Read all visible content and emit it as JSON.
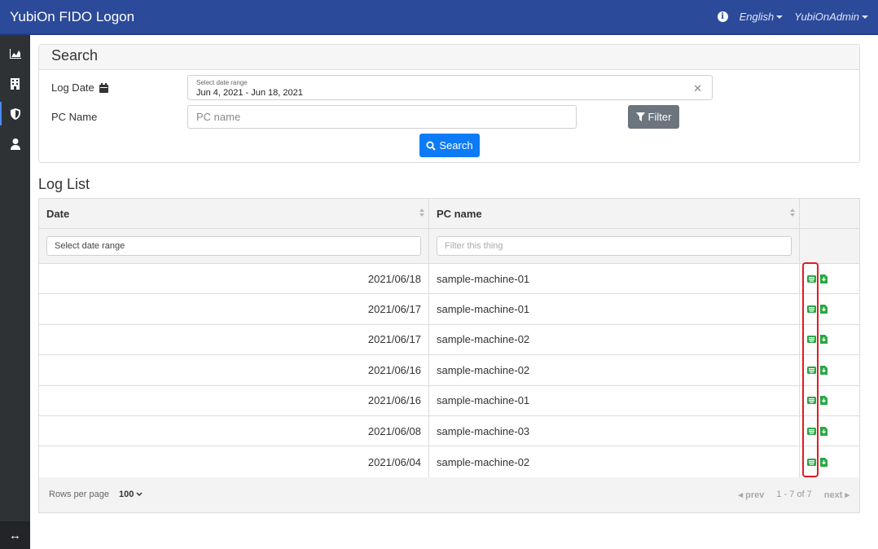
{
  "header": {
    "brand": "YubiOn FIDO Logon",
    "language": "English",
    "user": "YubiOnAdmin"
  },
  "sidebar": {
    "items": [
      {
        "icon": "area-chart-icon"
      },
      {
        "icon": "building-icon"
      },
      {
        "icon": "shield-icon",
        "active": true
      },
      {
        "icon": "user-icon"
      }
    ],
    "toggle_icon": "expand-arrows-icon"
  },
  "search": {
    "title": "Search",
    "log_date_label": "Log Date",
    "date_range_caption": "Select date range",
    "date_range_value": "Jun 4, 2021 - Jun 18, 2021",
    "pc_name_label": "PC Name",
    "pc_name_placeholder": "PC name",
    "filter_label": "Filter",
    "search_label": "Search"
  },
  "log_list": {
    "title": "Log List",
    "columns": [
      "Date",
      "PC name"
    ],
    "date_filter_placeholder": "Select date range",
    "pc_filter_placeholder": "Filter this thing",
    "rows": [
      {
        "date": "2021/06/18",
        "pc": "sample-machine-01"
      },
      {
        "date": "2021/06/17",
        "pc": "sample-machine-01"
      },
      {
        "date": "2021/06/17",
        "pc": "sample-machine-02"
      },
      {
        "date": "2021/06/16",
        "pc": "sample-machine-02"
      },
      {
        "date": "2021/06/16",
        "pc": "sample-machine-01"
      },
      {
        "date": "2021/06/08",
        "pc": "sample-machine-03"
      },
      {
        "date": "2021/06/04",
        "pc": "sample-machine-02"
      }
    ],
    "rows_per_page_label": "Rows per page",
    "rows_per_page_value": "100",
    "prev_label": "prev",
    "range_label": "1 - 7 of 7",
    "next_label": "next"
  },
  "colors": {
    "topbar": "#2c4a9a",
    "sidebar": "#2f3235",
    "primary_button": "#0d7bf5",
    "secondary_button": "#6c757d",
    "action_green": "#28a745",
    "highlight": "#e01b22"
  }
}
